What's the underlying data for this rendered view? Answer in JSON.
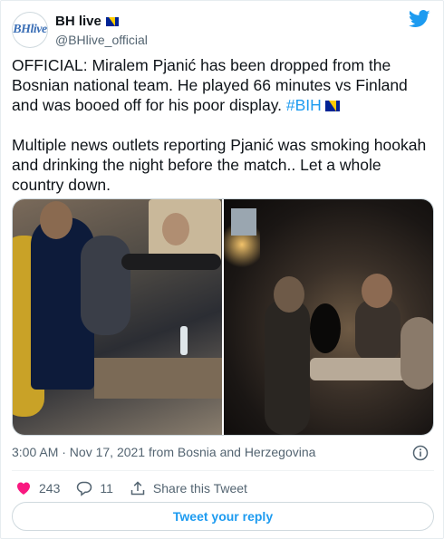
{
  "author": {
    "display_name": "BH live",
    "handle": "@BHlive_official",
    "avatar_text": "BHlive",
    "verified_flag_icon": "bosnia-flag-icon"
  },
  "logo_icon": "twitter-bird-icon",
  "tweet": {
    "paragraph1_text": "OFFICIAL: Miralem Pjanić has been dropped from the Bosnian national team. He played 66 minutes vs Finland and was booed off for his poor display. ",
    "hashtag": "#BIH",
    "paragraph2_text": "Multiple news outlets reporting Pjanić was smoking hookah and drinking the night before the match.. Let a whole country down."
  },
  "media": {
    "photos": [
      "photo-bar-table",
      "photo-dark-bar"
    ]
  },
  "meta": {
    "timestamp": "3:00 AM · Nov 17, 2021 from Bosnia and Herzegovina",
    "info_icon": "info-icon"
  },
  "actions": {
    "likes": "243",
    "replies": "11",
    "share_label": "Share this Tweet"
  },
  "reply_button_label": "Tweet your reply",
  "colors": {
    "accent": "#1d9bf0",
    "like": "#f91880",
    "text": "#0f1419",
    "secondary": "#536471"
  }
}
